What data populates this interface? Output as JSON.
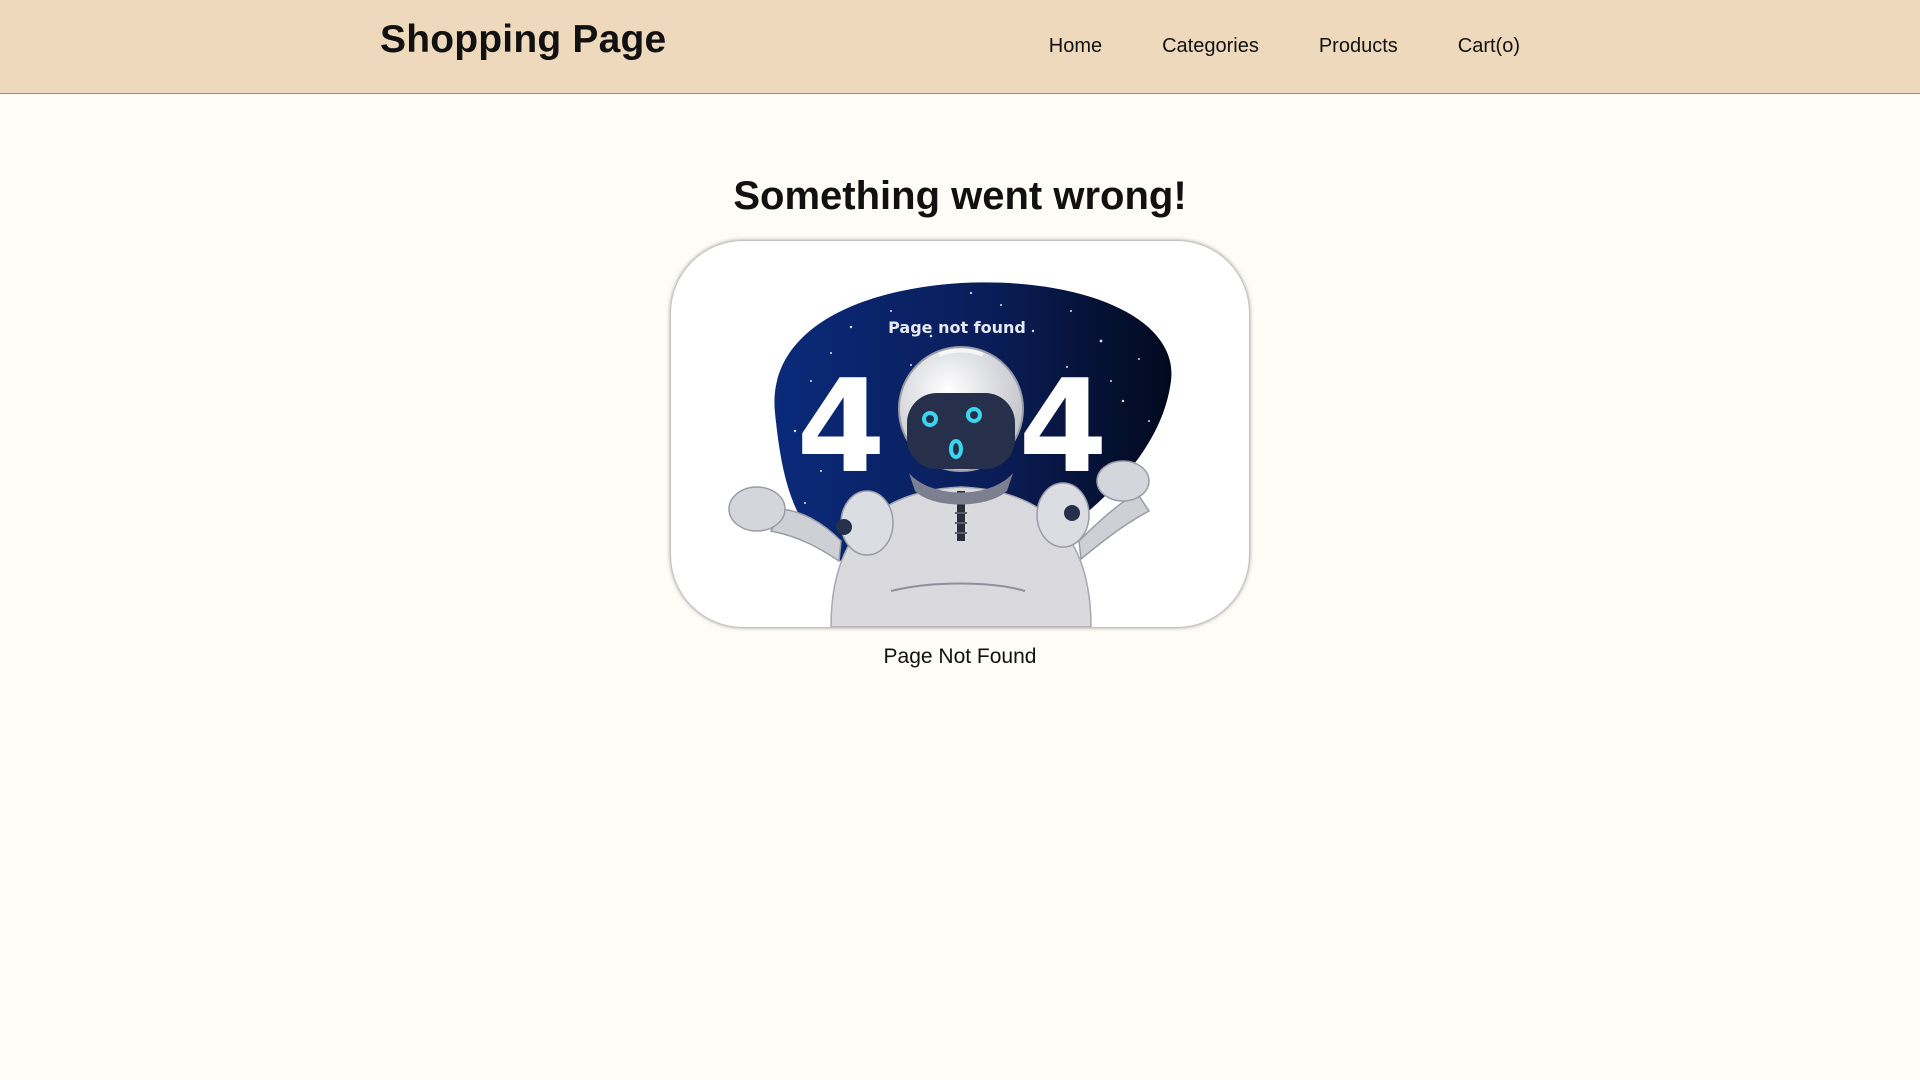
{
  "header": {
    "brand": "Shopping Page",
    "nav": [
      {
        "label": "Home"
      },
      {
        "label": "Categories"
      },
      {
        "label": "Products"
      },
      {
        "label": "Cart(o)"
      }
    ]
  },
  "main": {
    "title": "Something went wrong!",
    "illustration": {
      "subtitle": "Page not found",
      "digit_left": "4",
      "digit_right": "4",
      "icon": "robot-404-illustration"
    },
    "caption": "Page Not Found"
  },
  "colors": {
    "header_bg": "#eed9bc",
    "page_bg": "#fefcf6",
    "space_blue": "#0a1f5c",
    "robot_eye": "#3ad6f0"
  }
}
